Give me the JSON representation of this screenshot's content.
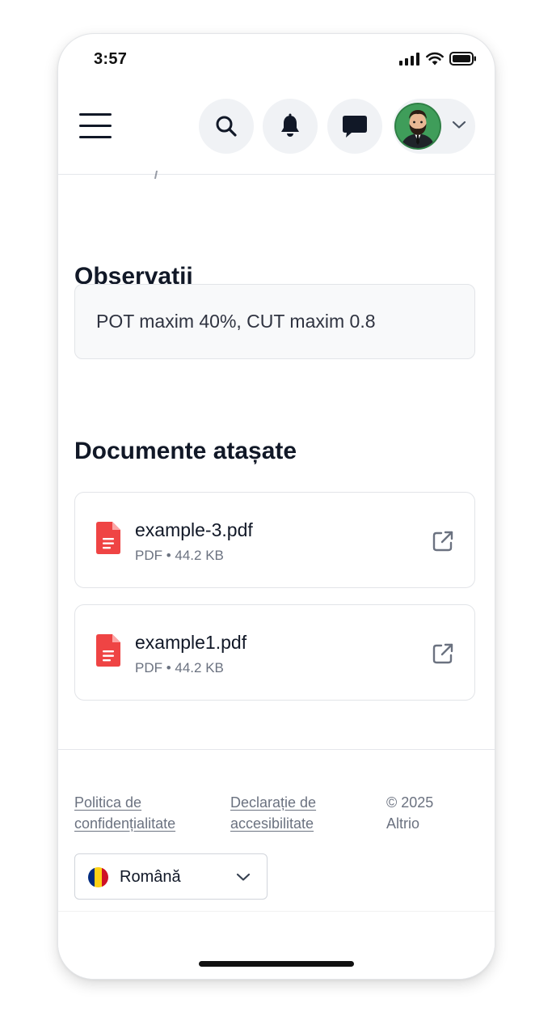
{
  "status_bar": {
    "time": "3:57"
  },
  "header": {
    "menu_icon": "hamburger-menu-icon",
    "search_icon": "search-icon",
    "notifications_icon": "bell-icon",
    "messages_icon": "chat-bubble-icon",
    "profile_icon": "avatar",
    "profile_chevron": "chevron-down-icon"
  },
  "observations": {
    "title": "Observații",
    "text": "POT maxim 40%, CUT maxim 0.8"
  },
  "documents": {
    "title": "Documente atașate",
    "items": [
      {
        "name": "example-3.pdf",
        "meta": "PDF • 44.2 KB",
        "icon": "pdf-file-icon",
        "action_icon": "external-link-icon"
      },
      {
        "name": "example1.pdf",
        "meta": "PDF • 44.2 KB",
        "icon": "pdf-file-icon",
        "action_icon": "external-link-icon"
      }
    ]
  },
  "footer": {
    "privacy_link": [
      "Politica de",
      "confidențialitate"
    ],
    "accessibility_link": [
      "Declarație de",
      "accesibilitate"
    ],
    "copyright": [
      "© 2025",
      "Altrio"
    ],
    "language": {
      "selected": "Română",
      "flag": "romania-flag-icon"
    }
  },
  "colors": {
    "pdf_red": "#ef4444",
    "header_button_bg": "#f0f2f5",
    "text_primary": "#111827",
    "text_muted": "#6b7280",
    "flag_blue": "#002b7f",
    "flag_yellow": "#fcd116",
    "flag_red": "#ce1126"
  }
}
